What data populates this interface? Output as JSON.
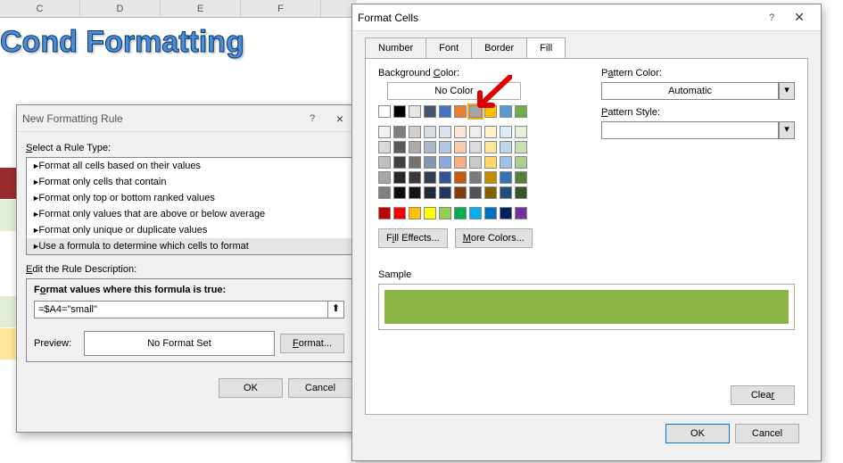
{
  "sheet": {
    "columns": [
      "C",
      "D",
      "E",
      "F"
    ],
    "wordart": "Cond Formatting"
  },
  "ruleDialog": {
    "title": "New Formatting Rule",
    "help": "?",
    "close": "×",
    "ruleTypeLabel": "Select a Rule Type:",
    "rules": [
      "Format all cells based on their values",
      "Format only cells that contain",
      "Format only top or bottom ranked values",
      "Format only values that are above or below average",
      "Format only unique or duplicate values",
      "Use a formula to determine which cells to format"
    ],
    "selectedRuleIndex": 5,
    "editDescLabel": "Edit the Rule Description:",
    "formulaLabel": "Format values where this formula is true:",
    "formulaValue": "=$A4=\"small\"",
    "previewLabel": "Preview:",
    "previewText": "No Format Set",
    "formatBtn": "Format...",
    "ok": "OK",
    "cancel": "Cancel"
  },
  "fmtDialog": {
    "title": "Format Cells",
    "help": "?",
    "close": "✕",
    "tabs": [
      "Number",
      "Font",
      "Border",
      "Fill"
    ],
    "activeTab": 3,
    "bgColorLabel": "Background Color:",
    "noColor": "No Color",
    "themeRow1": [
      "#ffffff",
      "#000000",
      "#e7e6e6",
      "#44546a",
      "#4472c4",
      "#ed7d31",
      "#a5a5a5",
      "#ffc000",
      "#5b9bd5",
      "#70ad47"
    ],
    "selectedSwatch": "#a5c77f",
    "fillEffects": "Fill Effects...",
    "moreColors": "More Colors...",
    "patternColorLabel": "Pattern Color:",
    "patternColorValue": "Automatic",
    "patternStyleLabel": "Pattern Style:",
    "patternStyleValue": "",
    "sampleLabel": "Sample",
    "sampleColor": "#8db546",
    "clear": "Clear",
    "ok": "OK",
    "cancel": "Cancel",
    "palette": [
      [
        "#f2f2f2",
        "#7f7f7f",
        "#d0cece",
        "#d6dce4",
        "#d9e1f2",
        "#fce4d6",
        "#ededed",
        "#fff2cc",
        "#ddebf7",
        "#e2efda"
      ],
      [
        "#d9d9d9",
        "#595959",
        "#aeaaaa",
        "#acb9ca",
        "#b4c6e7",
        "#f8cbad",
        "#dbdbdb",
        "#ffe699",
        "#bdd7ee",
        "#c6e0b4"
      ],
      [
        "#bfbfbf",
        "#404040",
        "#757171",
        "#8497b0",
        "#8ea9db",
        "#f4b084",
        "#c9c9c9",
        "#ffd966",
        "#9bc2e6",
        "#a9d08e"
      ],
      [
        "#a6a6a6",
        "#262626",
        "#3a3838",
        "#333f4f",
        "#305496",
        "#c65911",
        "#7b7b7b",
        "#bf8f00",
        "#2f75b5",
        "#548235"
      ],
      [
        "#808080",
        "#0d0d0d",
        "#161616",
        "#222b35",
        "#203764",
        "#833c0c",
        "#525252",
        "#806000",
        "#1f4e78",
        "#375623"
      ]
    ],
    "standard": [
      "#c00000",
      "#ff0000",
      "#ffc000",
      "#ffff00",
      "#92d050",
      "#00b050",
      "#00b0f0",
      "#0070c0",
      "#002060",
      "#7030a0"
    ]
  }
}
